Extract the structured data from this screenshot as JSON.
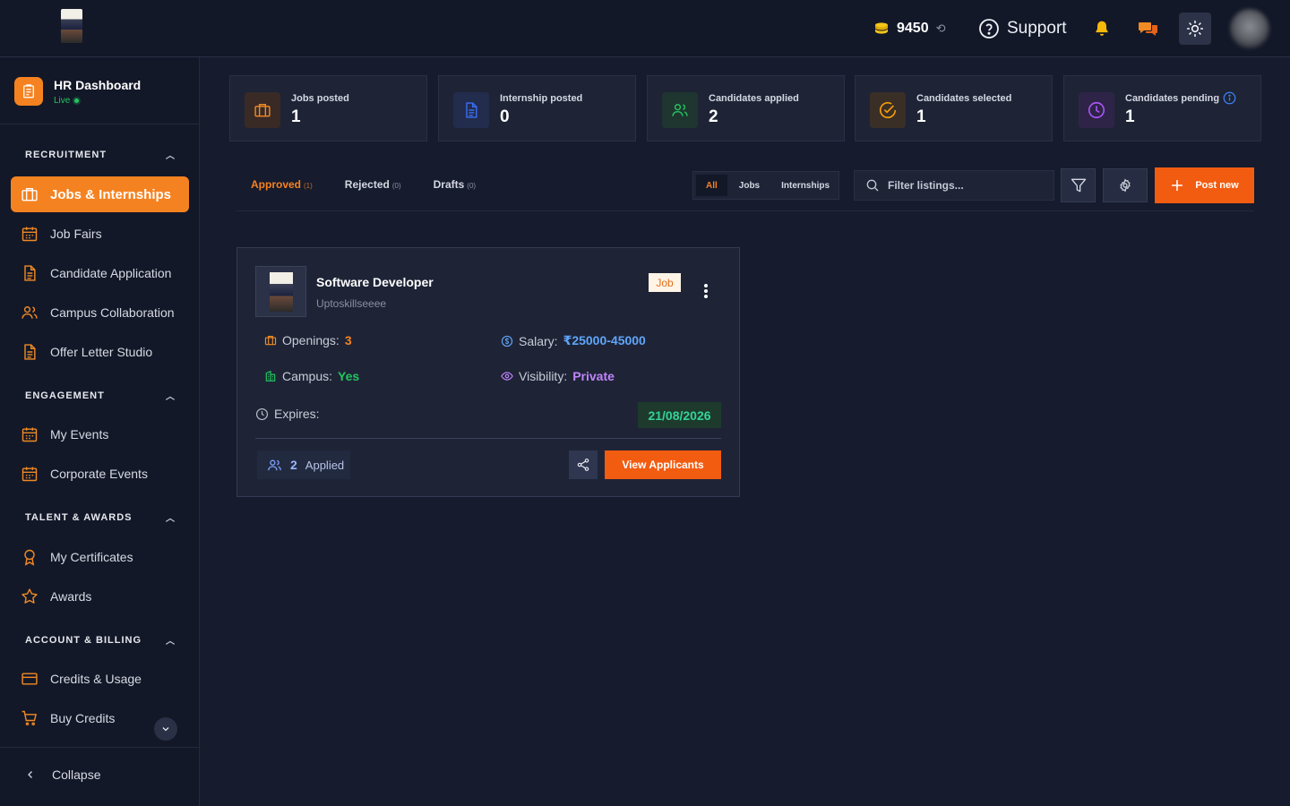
{
  "topbar": {
    "credits": "9450",
    "support_label": "Support"
  },
  "sidebar": {
    "brand_title": "HR Dashboard",
    "brand_status": "Live",
    "sections": {
      "recruitment": "RECRUITMENT",
      "engagement": "ENGAGEMENT",
      "talent": "TALENT & AWARDS",
      "billing": "ACCOUNT & BILLING"
    },
    "items": {
      "jobs": "Jobs & Internships",
      "job_fairs": "Job Fairs",
      "candidate_app": "Candidate Application",
      "campus": "Campus Collaboration",
      "offer_letter": "Offer Letter Studio",
      "my_events": "My Events",
      "corporate_events": "Corporate Events",
      "certificates": "My Certificates",
      "awards": "Awards",
      "credits_usage": "Credits & Usage",
      "buy_credits": "Buy Credits"
    },
    "collapse_label": "Collapse"
  },
  "stats": [
    {
      "label": "Jobs posted",
      "value": "1",
      "color": "#f58220"
    },
    {
      "label": "Internship posted",
      "value": "0",
      "color": "#3b6ef5"
    },
    {
      "label": "Candidates applied",
      "value": "2",
      "color": "#22c55e"
    },
    {
      "label": "Candidates selected",
      "value": "1",
      "color": "#f59e0b"
    },
    {
      "label": "Candidates pending",
      "value": "1",
      "color": "#a855f7"
    }
  ],
  "status_tabs": [
    {
      "label": "Approved",
      "count": "(1)"
    },
    {
      "label": "Rejected",
      "count": "(0)"
    },
    {
      "label": "Drafts",
      "count": "(0)"
    }
  ],
  "type_filter": [
    "All",
    "Jobs",
    "Internships"
  ],
  "search": {
    "placeholder": "Filter listings..."
  },
  "post_new_label": "Post new",
  "listing": {
    "title": "Software Developer",
    "company": "Uptoskillseeee",
    "type_badge": "Job",
    "openings_label": "Openings:",
    "openings": "3",
    "salary_label": "Salary:",
    "salary": "₹25000-45000",
    "campus_label": "Campus:",
    "campus": "Yes",
    "visibility_label": "Visibility:",
    "visibility": "Private",
    "expires_label": "Expires:",
    "expires": "21/08/2026",
    "applied_count": "2",
    "applied_label": "Applied",
    "view_label": "View Applicants"
  },
  "colors": {
    "accent": "#f58220",
    "button": "#f25c10",
    "success": "#22c55e",
    "info": "#60a5fa",
    "private": "#c084fc"
  }
}
